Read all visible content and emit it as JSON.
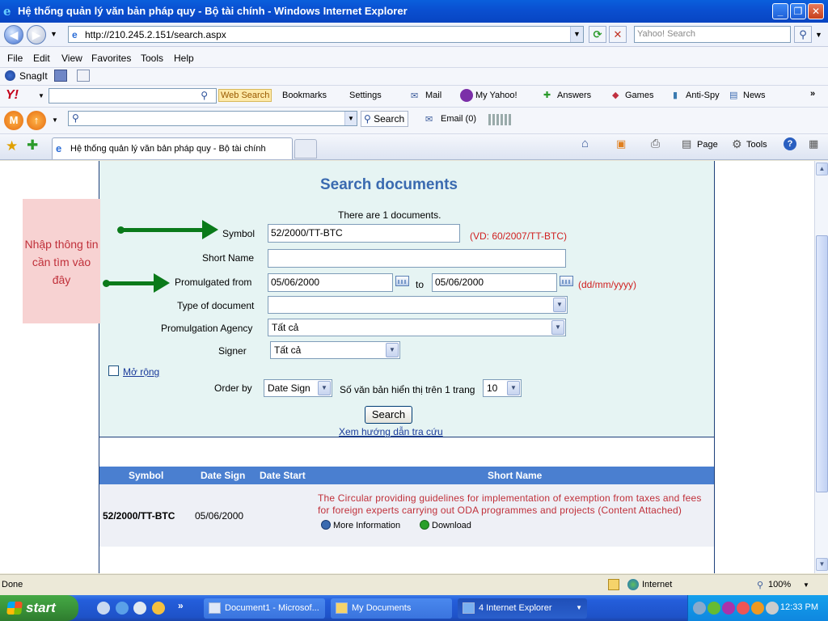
{
  "window": {
    "title": "Hệ thống quản lý văn bản pháp quy - Bộ tài chính - Windows Internet Explorer",
    "minimize": "_",
    "maximize": "❐",
    "close": "✕"
  },
  "address": {
    "url": "http://210.245.2.151/search.aspx",
    "search_placeholder": "Yahoo! Search"
  },
  "menu": [
    "File",
    "Edit",
    "View",
    "Favorites",
    "Tools",
    "Help"
  ],
  "snagit": {
    "label": "SnagIt"
  },
  "yahoo_toolbar": {
    "web_search": "Web Search",
    "bookmarks": "Bookmarks",
    "settings": "Settings",
    "mail": "Mail",
    "my_yahoo": "My Yahoo!",
    "answers": "Answers",
    "games": "Games",
    "anti_spy": "Anti-Spy",
    "news": "News"
  },
  "mail_toolbar": {
    "search": "Search",
    "email": "Email (0)"
  },
  "tab": {
    "title": "Hệ thống quản lý văn bản pháp quy - Bộ tài chính",
    "page": "Page",
    "tools": "Tools"
  },
  "form": {
    "heading": "Search documents",
    "count_text": "There are 1 documents.",
    "symbol_label": "Symbol",
    "symbol_value": "52/2000/TT-BTC",
    "symbol_hint": "(VD: 60/2007/TT-BTC)",
    "short_name_label": "Short Name",
    "short_name_value": "",
    "promulgated_label": "Promulgated from",
    "date_from": "05/06/2000",
    "to_label": "to",
    "date_to": "05/06/2000",
    "date_hint": "(dd/mm/yyyy)",
    "type_label": "Type of document",
    "type_value": "",
    "agency_label": "Promulgation Agency",
    "agency_value": "Tất cả",
    "signer_label": "Signer",
    "signer_value": "Tất cả",
    "expand_label": "Mở rộng",
    "order_label": "Order by",
    "order_value": "Date Sign",
    "per_page_label": "Số văn bản hiển thị trên 1 trang",
    "per_page_value": "10",
    "search_button": "Search",
    "guide_link": "Xem hướng dẫn tra cứu"
  },
  "annotation": {
    "note": "Nhập thông tin cần tìm vào đây"
  },
  "results": {
    "headers": [
      "Symbol",
      "Date Sign",
      "Date Start",
      "Short Name"
    ],
    "rows": [
      {
        "symbol": "52/2000/TT-BTC",
        "date_sign": "05/06/2000",
        "date_start": "",
        "short_name": "The Circular providing guidelines for implementation of exemption from taxes and fees for foreign experts carrying out ODA programmes and projects (Content Attached)",
        "more_info": "More Information",
        "download": "Download"
      }
    ]
  },
  "status": {
    "text": "Done",
    "zone": "Internet",
    "zoom": "100%"
  },
  "taskbar": {
    "start": "start",
    "tasks": [
      "Document1 - Microsof...",
      "My Documents",
      "4 Internet Explorer"
    ],
    "clock": "12:33 PM"
  }
}
